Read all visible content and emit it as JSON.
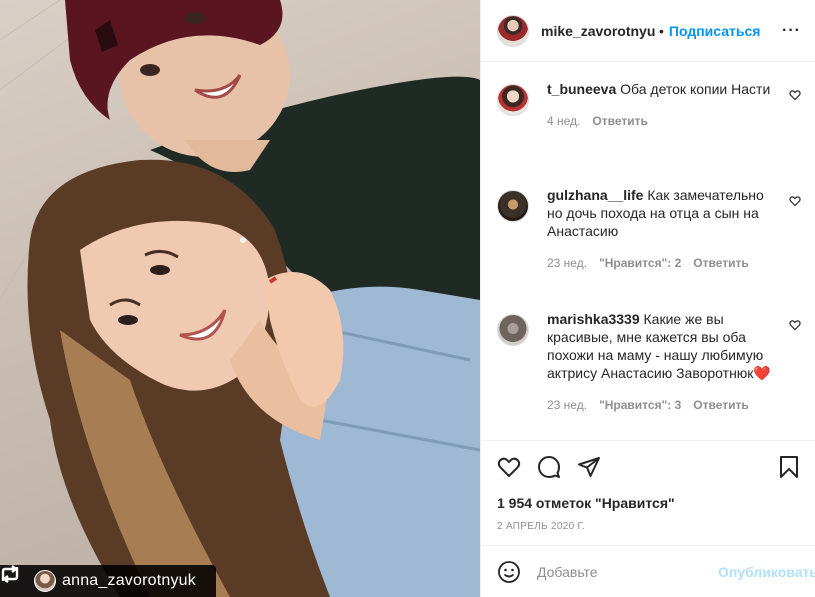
{
  "post": {
    "author": "mike_zavorotnyuk",
    "follow_label": "Подписаться",
    "separator": "•",
    "more_label": "···",
    "photo_tag_username": "anna_zavorotnyuk"
  },
  "comments": [
    {
      "username": "t_buneeva",
      "text": "Оба деток копии Насти",
      "age": "4 нед.",
      "likes": "",
      "reply_label": "Ответить"
    },
    {
      "username": "gulzhana__life",
      "text": "Как замечательно но дочь похода на отца а сын на Анастасию",
      "age": "23 нед.",
      "likes": "\"Нравится\": 2",
      "reply_label": "Ответить"
    },
    {
      "username": "marishka3339",
      "text": "Какие же вы красивые, мне кажется вы оба похожи на маму - нашу любимую актрису Анастасию Заворотнюк❤️",
      "age": "23 нед.",
      "likes": "\"Нравится\": 3",
      "reply_label": "Ответить"
    }
  ],
  "stats": {
    "likes_text": "1 954 отметок \"Нравится\"",
    "date": "2 АПРЕЛЬ 2020 Г."
  },
  "composer": {
    "placeholder": "Добавьте",
    "publish_label": "Опубликовать"
  },
  "icons": {
    "like": "heart-icon",
    "comment": "comment-bubble-icon",
    "share": "paper-plane-icon",
    "save": "bookmark-icon",
    "emoji": "smiley-icon",
    "repost": "repost-icon"
  },
  "colors": {
    "accent": "#0095f6",
    "publish_disabled": "#b2dffc",
    "meta_gray": "#8e8e8e",
    "text": "#262626"
  }
}
